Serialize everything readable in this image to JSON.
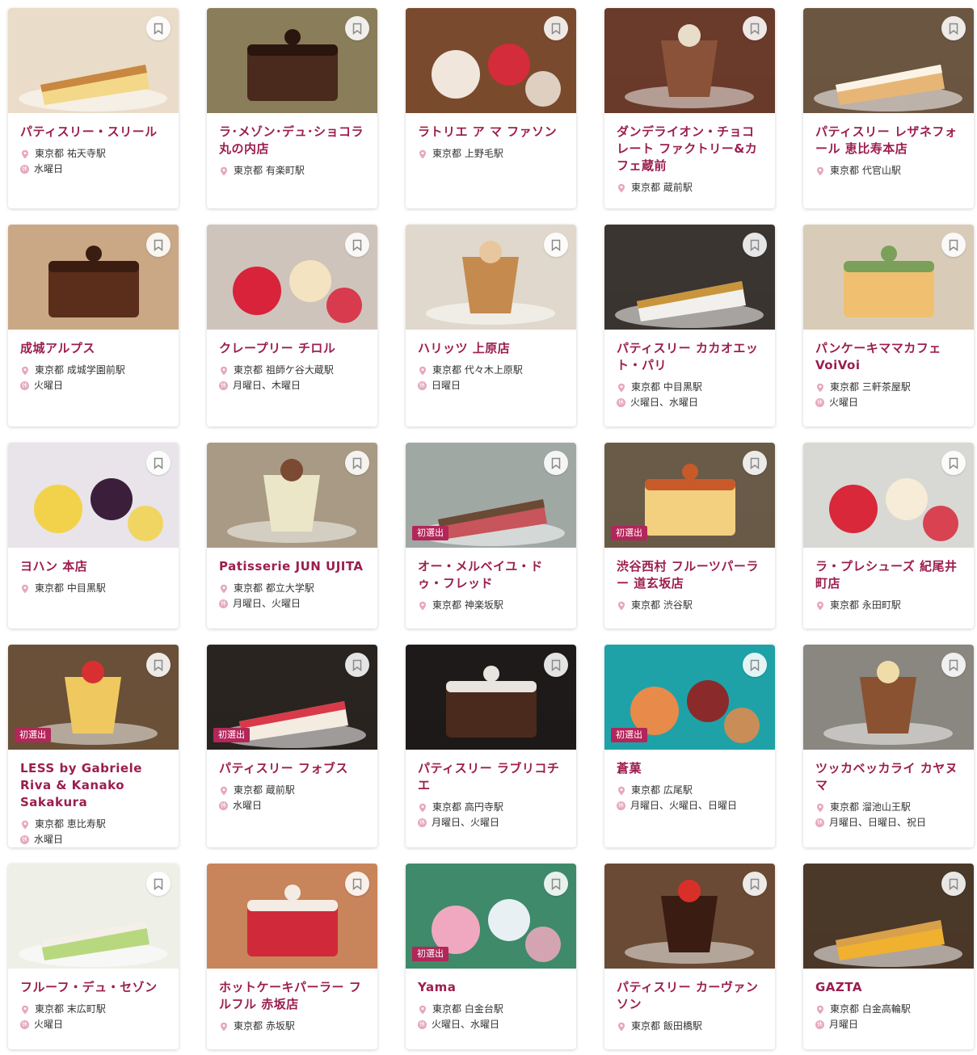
{
  "icons": {
    "bookmark": "bookmark-icon",
    "location": "location-pin-icon",
    "closed": "closed-day-icon"
  },
  "colors": {
    "accent": "#9b1e4e",
    "badge": "#b2265a",
    "pin": "#e6a7bf"
  },
  "badge_label": "初選出",
  "closed_mark": "休",
  "shops": [
    {
      "name": "パティスリー・スリール",
      "location": "東京都 祐天寺駅",
      "closed": "水曜日",
      "new": false,
      "img": [
        "#e9dcc8",
        "#f3d88a",
        "#c9873f"
      ]
    },
    {
      "name": "ラ･メゾン･デュ･ショコラ 丸の内店",
      "location": "東京都 有楽町駅",
      "closed": null,
      "new": false,
      "img": [
        "#8a7d5a",
        "#4a2a1c",
        "#2a160f"
      ]
    },
    {
      "name": "ラトリエ ア マ ファソン",
      "location": "東京都 上野毛駅",
      "closed": null,
      "new": false,
      "img": [
        "#7a4a2e",
        "#f0e6dc",
        "#d42c3b"
      ]
    },
    {
      "name": "ダンデライオン・チョコレート ファクトリー&カフェ蔵前",
      "location": "東京都 蔵前駅",
      "closed": null,
      "new": false,
      "img": [
        "#6a3a2a",
        "#8a5238",
        "#e8ddc8"
      ]
    },
    {
      "name": "パティスリー レザネフォール 恵比寿本店",
      "location": "東京都 代官山駅",
      "closed": null,
      "new": false,
      "img": [
        "#6b5642",
        "#e7b676",
        "#fbf4e6"
      ]
    },
    {
      "name": "成城アルプス",
      "location": "東京都 成城学園前駅",
      "closed": "火曜日",
      "new": false,
      "img": [
        "#caa886",
        "#5a2e1a",
        "#3a1c10"
      ]
    },
    {
      "name": "クレープリー チロル",
      "location": "東京都 祖師ケ谷大蔵駅",
      "closed": "月曜日、木曜日",
      "new": false,
      "img": [
        "#cfc4bc",
        "#d8233a",
        "#f4e3c0"
      ]
    },
    {
      "name": "ハリッツ 上原店",
      "location": "東京都 代々木上原駅",
      "closed": "日曜日",
      "new": false,
      "img": [
        "#e0d8cc",
        "#c58a4e",
        "#e8c79e"
      ]
    },
    {
      "name": "パティスリー カカオエット・パリ",
      "location": "東京都 中目黒駅",
      "closed": "火曜日、水曜日",
      "new": false,
      "img": [
        "#3a3530",
        "#f2f0ec",
        "#c8953c"
      ]
    },
    {
      "name": "パンケーキママカフェ VoiVoi",
      "location": "東京都 三軒茶屋駅",
      "closed": "火曜日",
      "new": false,
      "img": [
        "#d8ccb8",
        "#f0c070",
        "#7aa05a"
      ]
    },
    {
      "name": "ヨハン 本店",
      "location": "東京都 中目黒駅",
      "closed": null,
      "new": false,
      "img": [
        "#e8e4ea",
        "#f2d24a",
        "#3a1e3a"
      ]
    },
    {
      "name": "Patisserie JUN UJITA",
      "location": "東京都 都立大学駅",
      "closed": "月曜日、火曜日",
      "new": false,
      "img": [
        "#a89a84",
        "#ebe6c8",
        "#7a4a32"
      ]
    },
    {
      "name": "オー・メルベイユ・ドゥ・フレッド",
      "location": "東京都 神楽坂駅",
      "closed": null,
      "new": true,
      "img": [
        "#a0a8a4",
        "#c8545c",
        "#6a4a34"
      ]
    },
    {
      "name": "渋谷西村 フルーツパーラー 道玄坂店",
      "location": "東京都 渋谷駅",
      "closed": null,
      "new": true,
      "img": [
        "#6a5a48",
        "#f2d080",
        "#c85a2a"
      ]
    },
    {
      "name": "ラ・プレシューズ 紀尾井町店",
      "location": "東京都 永田町駅",
      "closed": null,
      "new": false,
      "img": [
        "#d8d8d4",
        "#d8283a",
        "#f6ecd8"
      ]
    },
    {
      "name": "LESS by Gabriele Riva & Kanako Sakakura",
      "location": "東京都 恵比寿駅",
      "closed": "水曜日",
      "new": true,
      "img": [
        "#6a5038",
        "#f0c860",
        "#d83030"
      ]
    },
    {
      "name": "パティスリー フォブス",
      "location": "東京都 蔵前駅",
      "closed": "水曜日",
      "new": true,
      "img": [
        "#2a2420",
        "#f4ece0",
        "#d83a4a"
      ]
    },
    {
      "name": "パティスリー ラブリコチエ",
      "location": "東京都 高円寺駅",
      "closed": "月曜日、火曜日",
      "new": false,
      "img": [
        "#1e1a1a",
        "#4a2a1c",
        "#e8e4e0"
      ]
    },
    {
      "name": "蒼菓",
      "location": "東京都 広尾駅",
      "closed": "月曜日、火曜日、日曜日",
      "new": true,
      "img": [
        "#1ea2a8",
        "#e88a4a",
        "#8a2a2a"
      ]
    },
    {
      "name": "ツッカベッカライ カヤヌマ",
      "location": "東京都 溜池山王駅",
      "closed": "月曜日、日曜日、祝日",
      "new": false,
      "img": [
        "#8a8680",
        "#8a5230",
        "#f0dca8"
      ]
    },
    {
      "name": "フルーフ・デュ・セゾン",
      "location": "東京都 末広町駅",
      "closed": "火曜日",
      "new": false,
      "img": [
        "#eef0e8",
        "#b8d880",
        "#f4f0e8"
      ]
    },
    {
      "name": "ホットケーキパーラー フルフル 赤坂店",
      "location": "東京都 赤坂駅",
      "closed": null,
      "new": false,
      "img": [
        "#c8845a",
        "#d02a3a",
        "#f4ece4"
      ]
    },
    {
      "name": "Yama",
      "location": "東京都 白金台駅",
      "closed": "火曜日、水曜日",
      "new": true,
      "img": [
        "#3e8a6a",
        "#f0a8c0",
        "#e8f0f4"
      ]
    },
    {
      "name": "パティスリー カーヴァンソン",
      "location": "東京都 飯田橋駅",
      "closed": null,
      "new": false,
      "img": [
        "#6a4a34",
        "#3a1c12",
        "#d83028"
      ]
    },
    {
      "name": "GAZTA",
      "location": "東京都 白金高輪駅",
      "closed": "月曜日",
      "new": false,
      "img": [
        "#4a3828",
        "#f0b030",
        "#d8a04a"
      ]
    }
  ]
}
